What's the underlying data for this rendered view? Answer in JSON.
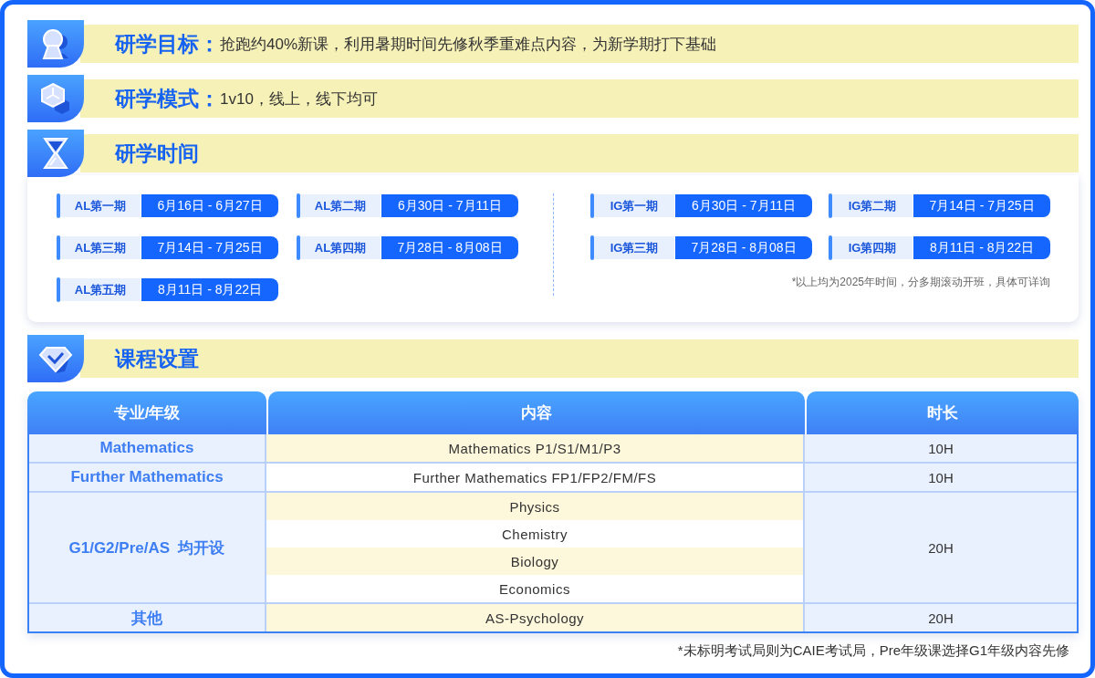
{
  "goal": {
    "title": "研学目标：",
    "text": "抢跑约40%新课，利用暑期时间先修秋季重难点内容，为新学期打下基础"
  },
  "mode": {
    "title": "研学模式：",
    "text": "1v10，线上，线下均可"
  },
  "time": {
    "title": "研学时间",
    "al_sessions": [
      {
        "label": "AL第一期",
        "dates": "6月16日 - 6月27日"
      },
      {
        "label": "AL第二期",
        "dates": "6月30日 - 7月11日"
      },
      {
        "label": "AL第三期",
        "dates": "7月14日 - 7月25日"
      },
      {
        "label": "AL第四期",
        "dates": "7月28日 - 8月08日"
      },
      {
        "label": "AL第五期",
        "dates": "8月11日 - 8月22日"
      }
    ],
    "ig_sessions": [
      {
        "label": "IG第一期",
        "dates": "6月30日 - 7月11日"
      },
      {
        "label": "IG第二期",
        "dates": "7月14日 - 7月25日"
      },
      {
        "label": "IG第三期",
        "dates": "7月28日 - 8月08日"
      },
      {
        "label": "IG第四期",
        "dates": "8月11日 - 8月22日"
      }
    ],
    "note": "*以上均为2025年时间，分多期滚动开班，具体可详询"
  },
  "courses": {
    "title": "课程设置",
    "columns": [
      "专业/年级",
      "内容",
      "时长"
    ],
    "rows": [
      {
        "subject": "Mathematics",
        "contents": [
          "Mathematics P1/S1/M1/P3"
        ],
        "duration": "10H"
      },
      {
        "subject": "Further Mathematics",
        "contents": [
          "Further Mathematics FP1/FP2/FM/FS"
        ],
        "duration": "10H"
      },
      {
        "subject": "G1/G2/Pre/AS  均开设",
        "contents": [
          "Physics",
          "Chemistry",
          "Biology",
          "Economics"
        ],
        "duration": "20H"
      },
      {
        "subject": "其他",
        "contents": [
          "AS-Psychology"
        ],
        "duration": "20H"
      }
    ],
    "note": "*未标明考试局则为CAIE考试局，Pre年级课选择G1年级内容先修"
  }
}
